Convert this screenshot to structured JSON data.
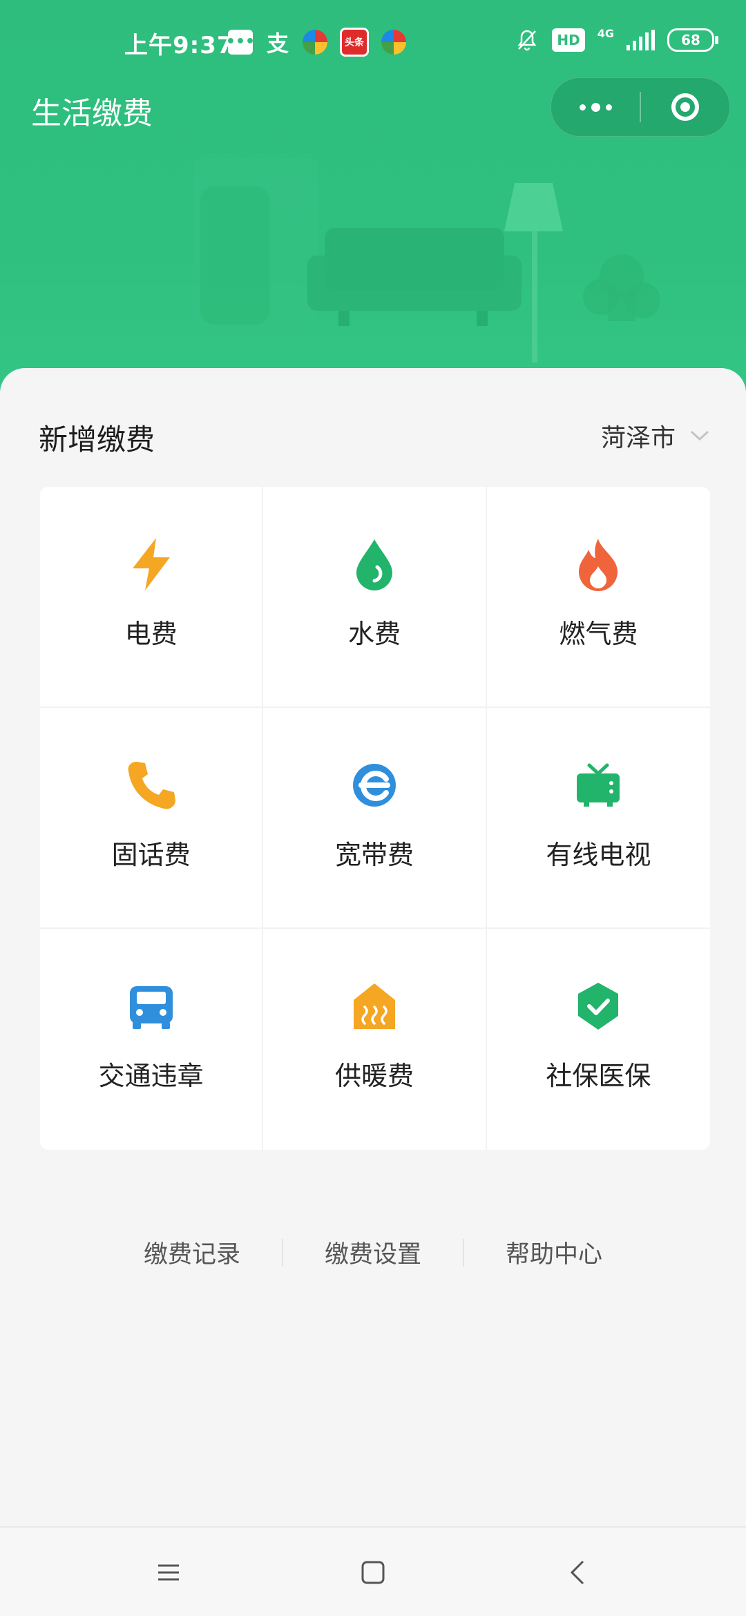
{
  "status_bar": {
    "time": "上午9:37",
    "app_icons": [
      "message-icon",
      "alipay-icon",
      "pinwheel-icon",
      "toutiao-icon",
      "pinwheel-icon"
    ],
    "toutiao_label": "头条",
    "zhi_label": "支",
    "hd_label": "HD",
    "network_label": "4G",
    "battery": "68"
  },
  "header": {
    "title": "生活缴费",
    "menu_button": "more-dots-icon",
    "close_button": "target-close-icon"
  },
  "section": {
    "title": "新增缴费",
    "city": "菏泽市"
  },
  "services": [
    {
      "label": "电费",
      "icon": "lightning-icon",
      "color": "#f5a623"
    },
    {
      "label": "水费",
      "icon": "water-drop-icon",
      "color": "#21b46a"
    },
    {
      "label": "燃气费",
      "icon": "flame-icon",
      "color": "#f0643c"
    },
    {
      "label": "固话费",
      "icon": "phone-icon",
      "color": "#f5a623"
    },
    {
      "label": "宽带费",
      "icon": "browser-e-icon",
      "color": "#2f8fdd"
    },
    {
      "label": "有线电视",
      "icon": "tv-icon",
      "color": "#21b46a"
    },
    {
      "label": "交通违章",
      "icon": "car-icon",
      "color": "#2f8fdd"
    },
    {
      "label": "供暖费",
      "icon": "heating-house-icon",
      "color": "#f5a623"
    },
    {
      "label": "社保医保",
      "icon": "shield-check-icon",
      "color": "#21b46a"
    }
  ],
  "footer": {
    "links": [
      "缴费记录",
      "缴费设置",
      "帮助中心"
    ]
  },
  "navbar": {
    "buttons": [
      "menu-icon",
      "home-square-icon",
      "back-chevron-icon"
    ]
  },
  "colors": {
    "brand_green": "#2ebd7d",
    "background": "#f5f5f6"
  }
}
